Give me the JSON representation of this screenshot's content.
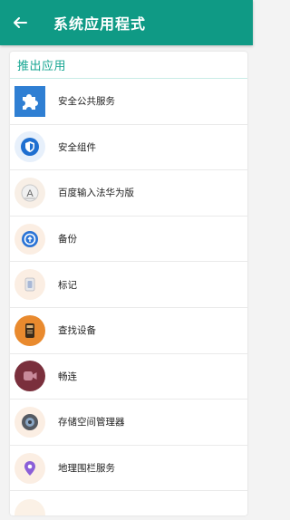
{
  "header": {
    "title": "系统应用程式",
    "bg_color": "#0f9a85"
  },
  "section": {
    "title": "推出应用"
  },
  "apps": [
    {
      "label": "安全公共服务",
      "icon": "puzzle-icon"
    },
    {
      "label": "安全组件",
      "icon": "shield-icon"
    },
    {
      "label": "百度输入法华为版",
      "icon": "keyboard-a-icon"
    },
    {
      "label": "备份",
      "icon": "backup-icon"
    },
    {
      "label": "标记",
      "icon": "tag-icon"
    },
    {
      "label": "查找设备",
      "icon": "find-device-icon"
    },
    {
      "label": "畅连",
      "icon": "meetime-icon"
    },
    {
      "label": "存储空间管理器",
      "icon": "storage-icon"
    },
    {
      "label": "地理围栏服务",
      "icon": "location-icon"
    }
  ]
}
